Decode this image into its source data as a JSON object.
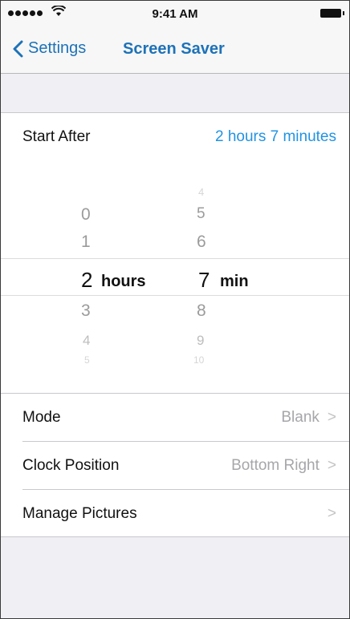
{
  "status_bar": {
    "time": "9:41 AM"
  },
  "nav": {
    "back_label": "Settings",
    "title": "Screen Saver"
  },
  "start_after": {
    "label": "Start After",
    "value": "2 hours 7 minutes"
  },
  "picker": {
    "hours": {
      "above": [
        "0",
        "1"
      ],
      "selected": "2",
      "below": [
        "3",
        "4",
        "5"
      ],
      "unit": "hours"
    },
    "minutes": {
      "above": [
        "4",
        "5",
        "6"
      ],
      "selected": "7",
      "below": [
        "8",
        "9",
        "10"
      ],
      "unit": "min"
    }
  },
  "settings": [
    {
      "label": "Mode",
      "value": "Blank",
      "chevron": ">"
    },
    {
      "label": "Clock Position",
      "value": "Bottom Right",
      "chevron": ">"
    },
    {
      "label": "Manage Pictures",
      "value": "",
      "chevron": ">"
    }
  ]
}
